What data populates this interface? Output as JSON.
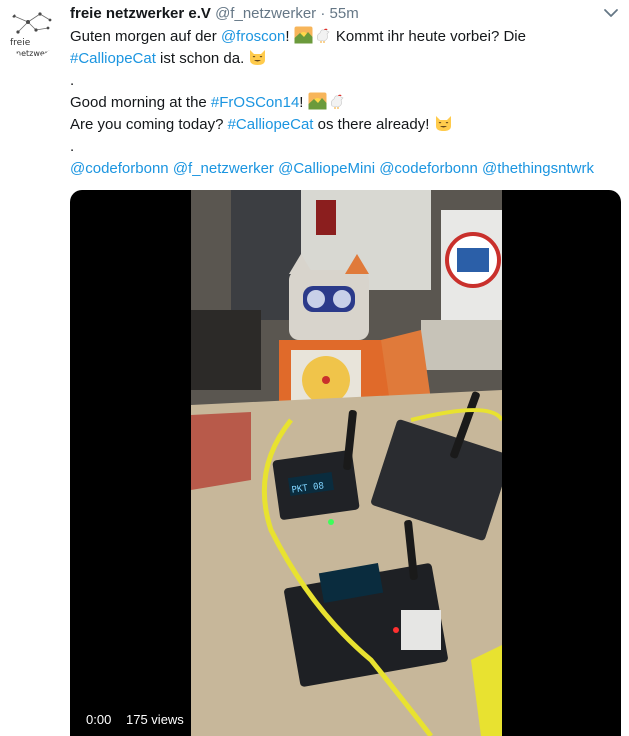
{
  "author": {
    "name": "freie netzwerker e.V",
    "handle": "@f_netzwerker",
    "separator": "·",
    "time": "55m",
    "avatar_text_top": "freie",
    "avatar_text_bottom": "netzwerker"
  },
  "tweet": {
    "l1_a": "Guten morgen auf der ",
    "l1_link": "@froscon",
    "l1_b": "! ",
    "l1_c": " Kommt ihr heute vorbei? Die",
    "l2_link": "#CalliopeCat",
    "l2_b": " ist schon da. ",
    "l3": ".",
    "l4_a": "Good morning at the ",
    "l4_link": "#FrOSCon14",
    "l4_b": "! ",
    "l5_a": "Are you coming today? ",
    "l5_link": "#CalliopeCat",
    "l5_b": " os there already! ",
    "l6": ".",
    "mentions": [
      "@codeforbonn",
      "@f_netzwerker",
      "@CalliopeMini",
      "@codeforbonn",
      "@thethingsntwrk"
    ]
  },
  "video": {
    "time": "0:00",
    "views": "175 views"
  },
  "icons": {
    "menu": "chevron-down-icon",
    "sunrise": "sunrise-emoji",
    "rooster": "rooster-emoji",
    "smile_cat": "smiling-cat-emoji"
  },
  "colors": {
    "link": "#1b95e0",
    "text": "#14171a",
    "muted": "#657786"
  }
}
